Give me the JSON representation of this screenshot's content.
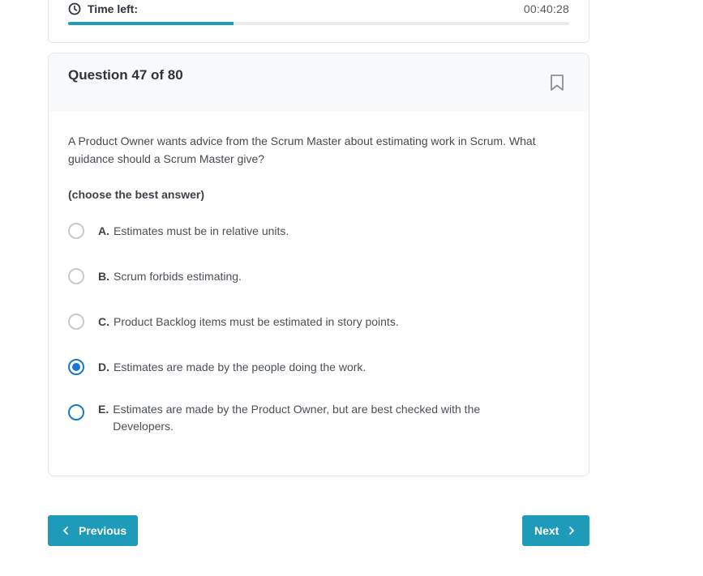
{
  "timer": {
    "label": "Time left:",
    "value": "00:40:28",
    "progress_fraction": 0.33
  },
  "question": {
    "title": "Question 47 of 80",
    "text": "A Product Owner wants advice from the Scrum Master about estimating work in Scrum. What guidance should a Scrum Master give?",
    "instruction": "(choose the best answer)",
    "options": [
      {
        "letter": "A.",
        "text": "Estimates must be in relative units.",
        "state": "unselected"
      },
      {
        "letter": "B.",
        "text": "Scrum forbids estimating.",
        "state": "unselected"
      },
      {
        "letter": "C.",
        "text": "Product Backlog items must be estimated in story points.",
        "state": "unselected"
      },
      {
        "letter": "D.",
        "text": "Estimates are made by the people doing the work.",
        "state": "selected"
      },
      {
        "letter": "E.",
        "text": "Estimates are made by the Product Owner, but are best checked with the Developers.",
        "state": "focused"
      }
    ]
  },
  "navigation": {
    "previous_label": "Previous",
    "next_label": "Next"
  },
  "colors": {
    "accent": "#1d9bb9",
    "progress": "#1e9bbd",
    "radio_selected": "#1878d1"
  },
  "icons": {
    "timer": "clock-icon",
    "bookmark": "bookmark-icon",
    "previous": "chevron-left-icon",
    "next": "chevron-right-icon"
  }
}
